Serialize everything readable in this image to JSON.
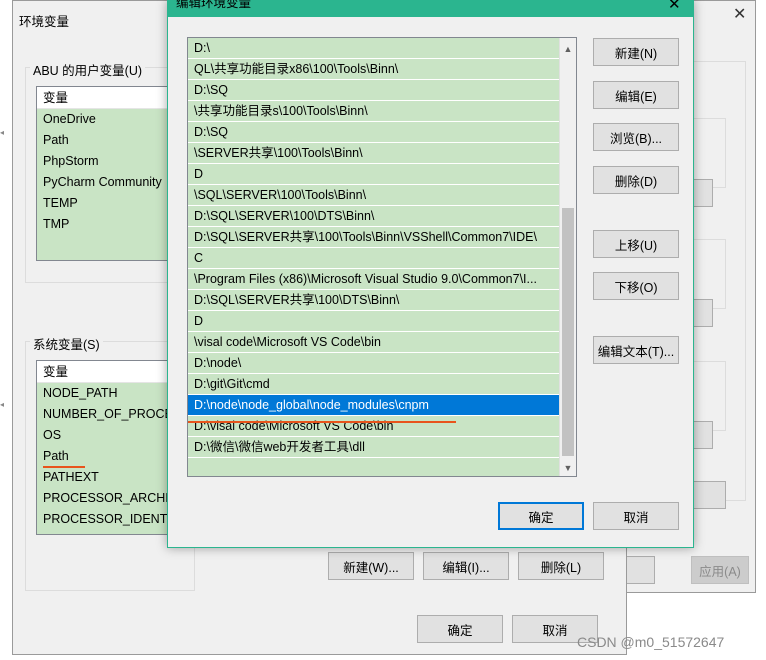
{
  "bg_window": {
    "close_glyph": "✕",
    "apply_label": "应用(A)"
  },
  "env_window": {
    "title": "环境变量",
    "user_group_label": "ABU 的用户变量(U)",
    "user_header": "变量",
    "user_vars": [
      "OneDrive",
      "Path",
      "PhpStorm",
      "PyCharm Community",
      "TEMP",
      "TMP"
    ],
    "sys_group_label": "系统变量(S)",
    "sys_header": "变量",
    "sys_vars": [
      "NODE_PATH",
      "NUMBER_OF_PROCES",
      "OS",
      "Path",
      "PATHEXT",
      "PROCESSOR_ARCHITE",
      "PROCESSOR_IDENTIF"
    ],
    "new_label": "新建(W)...",
    "edit_label": "编辑(I)...",
    "delete_label": "删除(L)",
    "ok_label": "确定",
    "cancel_label": "取消"
  },
  "edit_dialog": {
    "title": "编辑环境变量",
    "close_glyph": "✕",
    "entries": [
      "D:\\",
      "QL\\共享功能目录x86\\100\\Tools\\Binn\\",
      "D:\\SQ",
      "\\共享功能目录s\\100\\Tools\\Binn\\",
      "D:\\SQ",
      "\\SERVER共享\\100\\Tools\\Binn\\",
      "D",
      "\\SQL\\SERVER\\100\\Tools\\Binn\\",
      "D:\\SQL\\SERVER\\100\\DTS\\Binn\\",
      "D:\\SQL\\SERVER共享\\100\\Tools\\Binn\\VSShell\\Common7\\IDE\\",
      "C",
      "\\Program Files (x86)\\Microsoft Visual Studio 9.0\\Common7\\I...",
      "D:\\SQL\\SERVER共享\\100\\DTS\\Binn\\",
      "D",
      "\\visal code\\Microsoft VS Code\\bin",
      "D:\\node\\",
      "D:\\git\\Git\\cmd",
      "D:\\node\\node_global\\node_modules\\cnpm",
      "D:\\visal code\\Microsoft VS Code\\bin",
      "D:\\微信\\微信web开发者工具\\dll"
    ],
    "selected_index": 17,
    "buttons": {
      "new": "新建(N)",
      "edit": "编辑(E)",
      "browse": "浏览(B)...",
      "delete": "删除(D)",
      "up": "上移(U)",
      "down": "下移(O)",
      "edit_text": "编辑文本(T)..."
    },
    "ok_label": "确定",
    "cancel_label": "取消",
    "scroll_up_glyph": "▲",
    "scroll_down_glyph": "▼"
  },
  "watermark": "CSDN @m0_51572647",
  "colors": {
    "list_bg": "#c9e4c5",
    "selection": "#0078d7",
    "dialog_titlebar": "#2bb58f",
    "annotation_line": "#e8541c"
  }
}
